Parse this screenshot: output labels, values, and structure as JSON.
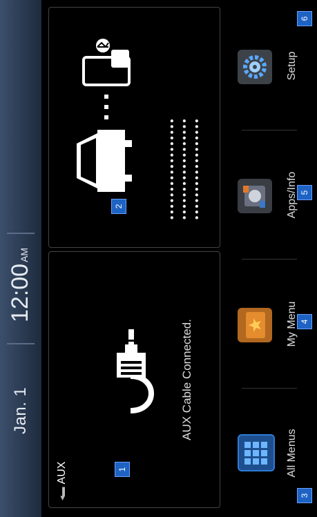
{
  "status": {
    "date": "Jan. 1",
    "time": "12:00",
    "ampm": "AM"
  },
  "aux": {
    "title": "AUX",
    "status": "AUX Cable Connected.",
    "marker": "1"
  },
  "phone": {
    "marker": "2",
    "masked": "••••••••••••••••••\n••••••••••••••••••\n••••••••••••••••••"
  },
  "dock": [
    {
      "label": "All Menus",
      "marker": "3"
    },
    {
      "label": "My Menu",
      "marker": "4"
    },
    {
      "label": "Apps/Info",
      "marker": "5"
    },
    {
      "label": "Setup",
      "marker": "6"
    }
  ]
}
